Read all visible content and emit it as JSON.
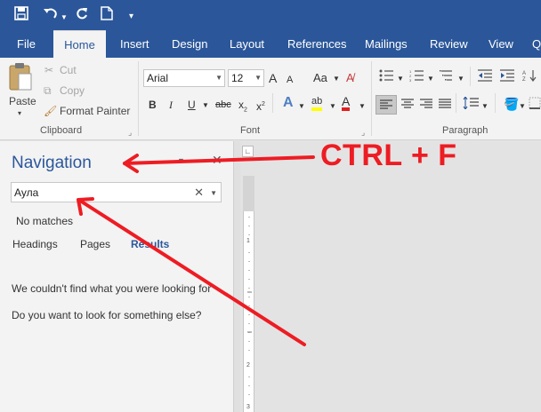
{
  "quick_access": {
    "save_icon": "save-icon",
    "undo_icon": "undo-icon",
    "redo_icon": "redo-icon",
    "new_icon": "new-document-icon",
    "customize_icon": "customize-toolbar-icon"
  },
  "tabs": [
    {
      "label": "File"
    },
    {
      "label": "Home"
    },
    {
      "label": "Insert"
    },
    {
      "label": "Design"
    },
    {
      "label": "Layout"
    },
    {
      "label": "References"
    },
    {
      "label": "Mailings"
    },
    {
      "label": "Review"
    },
    {
      "label": "View"
    },
    {
      "label": "Q"
    }
  ],
  "clipboard": {
    "paste_label": "Paste",
    "cut_label": "Cut",
    "copy_label": "Copy",
    "format_painter_label": "Format Painter",
    "group_label": "Clipboard"
  },
  "font": {
    "family": "Arial",
    "size": "12",
    "grow": "A",
    "shrink": "A",
    "change_case": "Aa",
    "bold": "B",
    "italic": "I",
    "underline": "U",
    "strikethrough": "abc",
    "subscript": "x",
    "superscript": "x",
    "text_effects": "A",
    "highlight": "ab",
    "font_color": "A",
    "group_label": "Font"
  },
  "paragraph": {
    "group_label": "Paragraph"
  },
  "navigation": {
    "title": "Navigation",
    "search_value": "Аула",
    "status": "No matches",
    "tabs": [
      {
        "label": "Headings"
      },
      {
        "label": "Pages"
      },
      {
        "label": "Results"
      }
    ],
    "message1": "We couldn't find what you were looking for",
    "message2": "Do you want to look for something else?"
  },
  "annotation": {
    "text": "CTRL + F",
    "color": "#ee1c23"
  },
  "colors": {
    "word_blue": "#2b579a",
    "ribbon_bg": "#f3f3f3",
    "results_tab": "#2b579a"
  }
}
